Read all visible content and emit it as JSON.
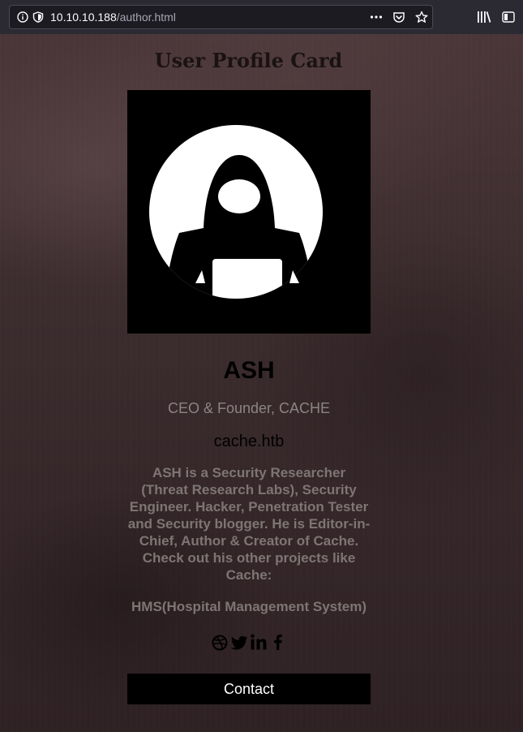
{
  "browser": {
    "url_host": "10.10.10.188",
    "url_path": "/author.html"
  },
  "page": {
    "title": "User Profile Card"
  },
  "profile": {
    "name": "ASH",
    "role": "CEO & Founder, CACHE",
    "domain": "cache.htb",
    "bio": "ASH is a Security Researcher (Threat Research Labs), Security Engineer. Hacker, Penetration Tester and Security blogger. He is Editor-in-Chief, Author & Creator of Cache. Check out his other projects like Cache:",
    "project": "HMS(Hospital Management System)",
    "socials": [
      "dribbble-icon",
      "twitter-icon",
      "linkedin-icon",
      "facebook-icon"
    ],
    "contact_label": "Contact"
  },
  "colors": {
    "muted_text": "#8c8483",
    "card_black": "#000000",
    "toolbar": "#2b2a33"
  }
}
